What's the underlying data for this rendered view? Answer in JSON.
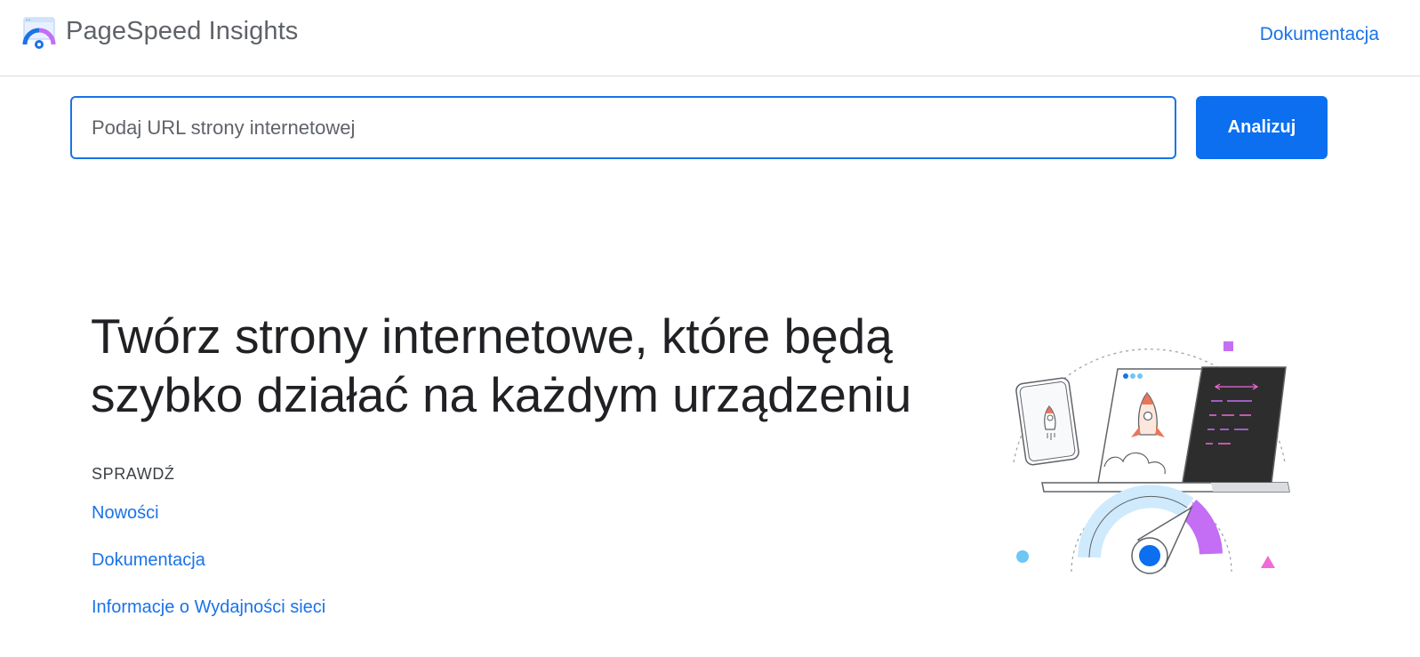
{
  "header": {
    "brand": "PageSpeed Insights",
    "doc_link": "Dokumentacja",
    "logo_icon": "pagespeed-gauge-icon"
  },
  "search": {
    "placeholder": "Podaj URL strony internetowej",
    "value": "",
    "button_label": "Analizuj"
  },
  "hero": {
    "title": "Twórz strony internetowe, które będą szybko działać na każdym urządzeniu",
    "check_label": "SPRAWDŹ",
    "links": [
      "Nowości",
      "Dokumentacja",
      "Informacje o Wydajności sieci"
    ]
  },
  "colors": {
    "accent": "#1a73e8",
    "button": "#0b6ff0",
    "text": "#202124",
    "muted": "#5f6368",
    "purple": "#c36ef4",
    "light_blue": "#cfeafc"
  }
}
